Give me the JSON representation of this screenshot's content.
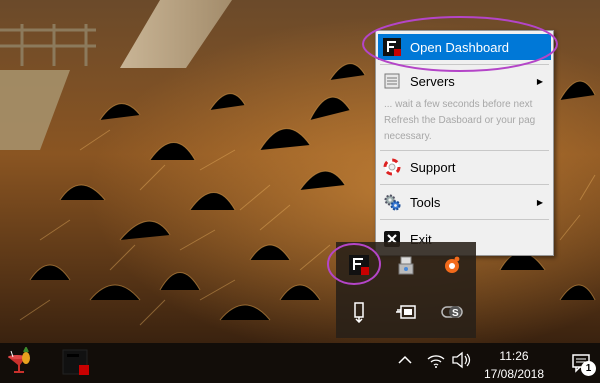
{
  "context_menu": {
    "items": [
      {
        "label": "Open Dashboard",
        "icon": "app-logo-icon",
        "highlighted": true
      },
      {
        "label": "Servers",
        "icon": "server-list-icon",
        "submenu": true
      },
      {
        "label": "Support",
        "icon": "lifebuoy-icon"
      },
      {
        "label": "Tools",
        "icon": "gears-icon",
        "submenu": true
      },
      {
        "label": "Exit",
        "icon": "close-icon"
      }
    ],
    "info_lines": [
      "... wait a few seconds before next",
      "Refresh the Dasboard or your pag",
      "necessary."
    ]
  },
  "system_tray": {
    "overflow_icons": [
      "app-logo-icon",
      "usb-drive-icon",
      "avast-icon",
      "removable-device-icon",
      "power-plug-icon",
      "sync-icon"
    ],
    "clock_time": "11:26",
    "clock_date": "17/08/2018",
    "notification_count": "1"
  },
  "taskbar": {
    "pinned": [
      "pineapple-cocktail-icon",
      "app-logo-icon"
    ]
  },
  "colors": {
    "highlight": "#0078d7",
    "annotation": "#b445c8",
    "taskbar": "#120d09"
  }
}
